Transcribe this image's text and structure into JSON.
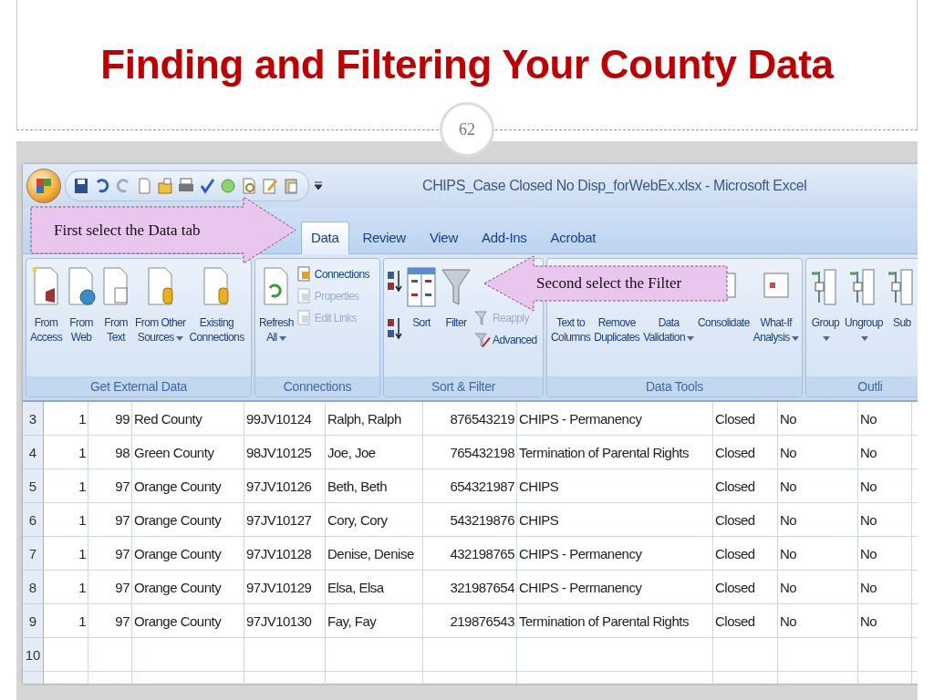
{
  "slide": {
    "title": "Finding and Filtering Your County Data",
    "page_number": "62"
  },
  "excel": {
    "window_title": "CHIPS_Case Closed No Disp_forWebEx.xlsx - Microsoft Excel",
    "tabs": [
      {
        "label": "Data",
        "selected": true
      },
      {
        "label": "Review",
        "selected": false
      },
      {
        "label": "View",
        "selected": false
      },
      {
        "label": "Add-Ins",
        "selected": false
      },
      {
        "label": "Acrobat",
        "selected": false
      }
    ],
    "ribbon_groups": [
      {
        "label": "Get External Data",
        "items": [
          {
            "kind": "large",
            "lines": [
              "From",
              "Access"
            ],
            "dropdown": false
          },
          {
            "kind": "large",
            "lines": [
              "From",
              "Web"
            ],
            "dropdown": false
          },
          {
            "kind": "large",
            "lines": [
              "From",
              "Text"
            ],
            "dropdown": false
          },
          {
            "kind": "large",
            "lines": [
              "From Other",
              "Sources"
            ],
            "dropdown": true
          },
          {
            "kind": "large",
            "lines": [
              "Existing",
              "Connections"
            ],
            "dropdown": false
          }
        ]
      },
      {
        "label": "Connections",
        "items": [
          {
            "kind": "large",
            "lines": [
              "Refresh",
              "All"
            ],
            "dropdown": true
          },
          {
            "kind": "stack",
            "buttons": [
              {
                "label": "Connections",
                "disabled": false
              },
              {
                "label": "Properties",
                "disabled": true
              },
              {
                "label": "Edit Links",
                "disabled": true
              }
            ]
          }
        ]
      },
      {
        "label": "Sort & Filter",
        "items": [
          {
            "kind": "sort_pair"
          },
          {
            "kind": "large",
            "lines": [
              "Sort"
            ],
            "dropdown": false
          },
          {
            "kind": "large",
            "lines": [
              "Filter"
            ],
            "dropdown": false
          },
          {
            "kind": "stack",
            "buttons": [
              {
                "label": "Reapply",
                "disabled": true
              },
              {
                "label": "Advanced",
                "disabled": false
              }
            ]
          }
        ]
      },
      {
        "label": "Data Tools",
        "items": [
          {
            "kind": "large",
            "lines": [
              "Text to",
              "Columns"
            ],
            "dropdown": false
          },
          {
            "kind": "large",
            "lines": [
              "Remove",
              "Duplicates"
            ],
            "dropdown": false
          },
          {
            "kind": "large",
            "lines": [
              "Data",
              "Validation"
            ],
            "dropdown": true
          },
          {
            "kind": "large",
            "lines": [
              "Consolidate"
            ],
            "dropdown": false
          },
          {
            "kind": "large",
            "lines": [
              "What-If",
              "Analysis"
            ],
            "dropdown": true
          }
        ]
      },
      {
        "label": "Outli",
        "items": [
          {
            "kind": "large",
            "lines": [
              "Group"
            ],
            "dropdown": true
          },
          {
            "kind": "large",
            "lines": [
              "Ungroup"
            ],
            "dropdown": true
          },
          {
            "kind": "large",
            "lines": [
              "Sub"
            ],
            "dropdown": false
          }
        ]
      }
    ],
    "rows": [
      {
        "row": "3",
        "cells": [
          "1",
          "99",
          "Red County",
          "99JV10124",
          "Ralph, Ralph",
          "876543219",
          "CHIPS - Permanency",
          "Closed",
          "No",
          "No"
        ]
      },
      {
        "row": "4",
        "cells": [
          "1",
          "98",
          "Green County",
          "98JV10125",
          "Joe, Joe",
          "765432198",
          "Termination of Parental Rights",
          "Closed",
          "No",
          "No"
        ]
      },
      {
        "row": "5",
        "cells": [
          "1",
          "97",
          "Orange County",
          "97JV10126",
          "Beth, Beth",
          "654321987",
          "CHIPS",
          "Closed",
          "No",
          "No"
        ]
      },
      {
        "row": "6",
        "cells": [
          "1",
          "97",
          "Orange County",
          "97JV10127",
          "Cory, Cory",
          "543219876",
          "CHIPS",
          "Closed",
          "No",
          "No"
        ]
      },
      {
        "row": "7",
        "cells": [
          "1",
          "97",
          "Orange County",
          "97JV10128",
          "Denise, Denise",
          "432198765",
          "CHIPS - Permanency",
          "Closed",
          "No",
          "No"
        ]
      },
      {
        "row": "8",
        "cells": [
          "1",
          "97",
          "Orange County",
          "97JV10129",
          "Elsa, Elsa",
          "321987654",
          "CHIPS - Permanency",
          "Closed",
          "No",
          "No"
        ]
      },
      {
        "row": "9",
        "cells": [
          "1",
          "97",
          "Orange County",
          "97JV10130",
          "Fay, Fay",
          "219876543",
          "Termination of Parental Rights",
          "Closed",
          "No",
          "No"
        ]
      }
    ],
    "empty_rows": [
      "10"
    ]
  },
  "callouts": [
    {
      "text": "First select the Data tab",
      "kind": "right"
    },
    {
      "text": "Second select the Filter",
      "kind": "left"
    }
  ]
}
